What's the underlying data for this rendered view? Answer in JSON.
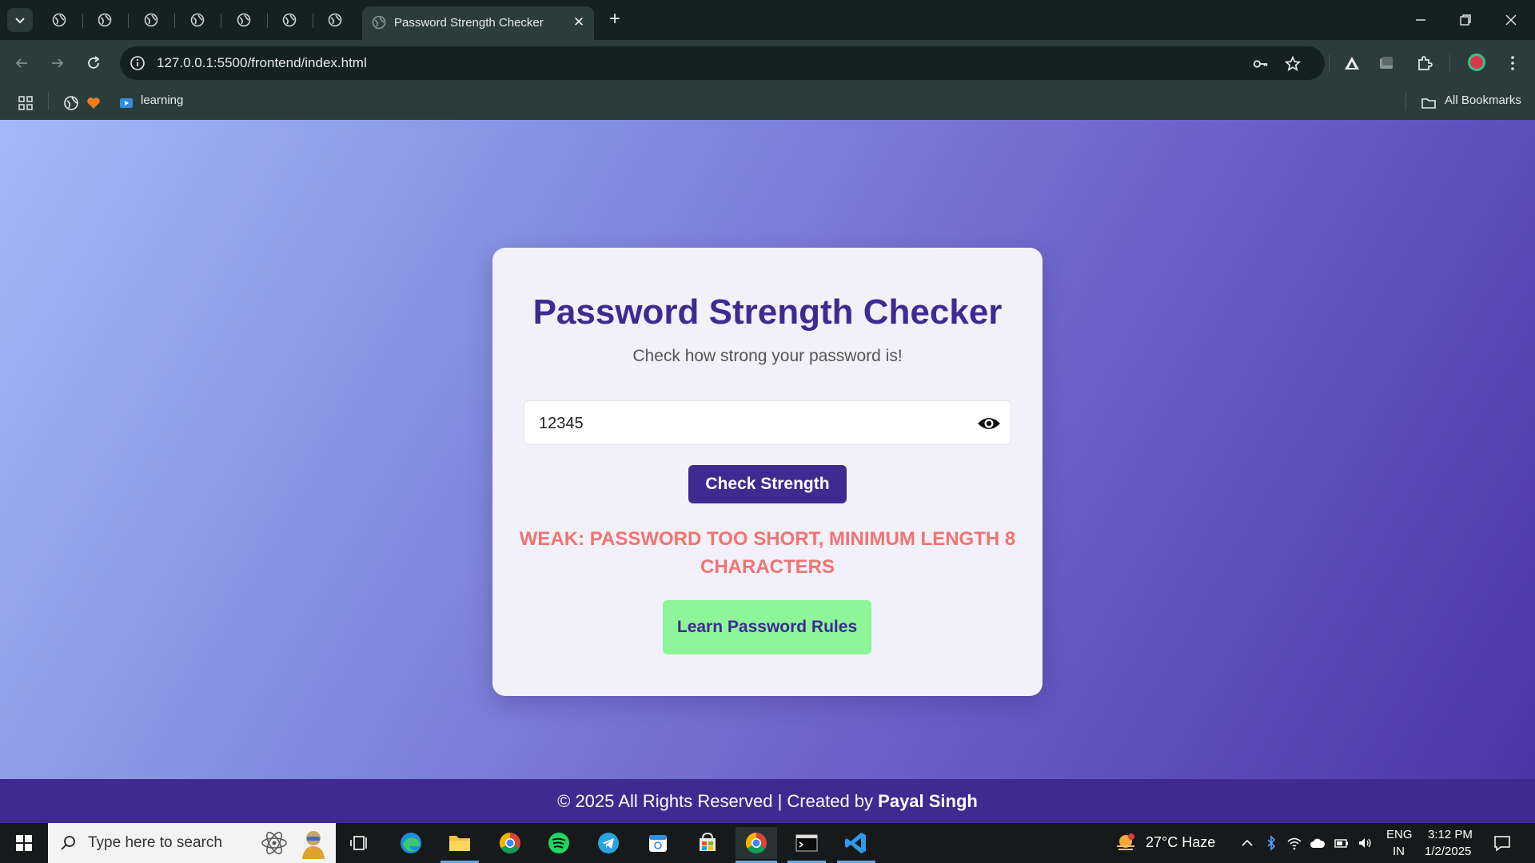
{
  "browser": {
    "active_tab_title": "Password Strength Checker",
    "tab_close": "✕",
    "new_tab": "+",
    "url": "127.0.0.1:5500/frontend/index.html",
    "bookmarks": [
      {
        "label": "learning"
      }
    ],
    "all_bookmarks": "All Bookmarks"
  },
  "page": {
    "title": "Password Strength Checker",
    "subtitle": "Check how strong your password is!",
    "password_value": "12345",
    "check_button": "Check Strength",
    "result_message": "Weak: Password too short, minimum length 8 characters",
    "rules_button": "Learn Password Rules",
    "footer_prefix": "© 2025 All Rights Reserved | Created by",
    "footer_author": "Payal Singh"
  },
  "taskbar": {
    "search_placeholder": "Type here to search",
    "weather": "27°C  Haze",
    "lang_top": "ENG",
    "lang_bottom": "IN",
    "time": "3:12 PM",
    "date": "1/2/2025"
  },
  "colors": {
    "accent": "#3f2a91",
    "weak": "#f07472",
    "rules_button": "#8ef59a",
    "chrome_dark": "#132120",
    "chrome_mid": "#2b3d3b"
  }
}
